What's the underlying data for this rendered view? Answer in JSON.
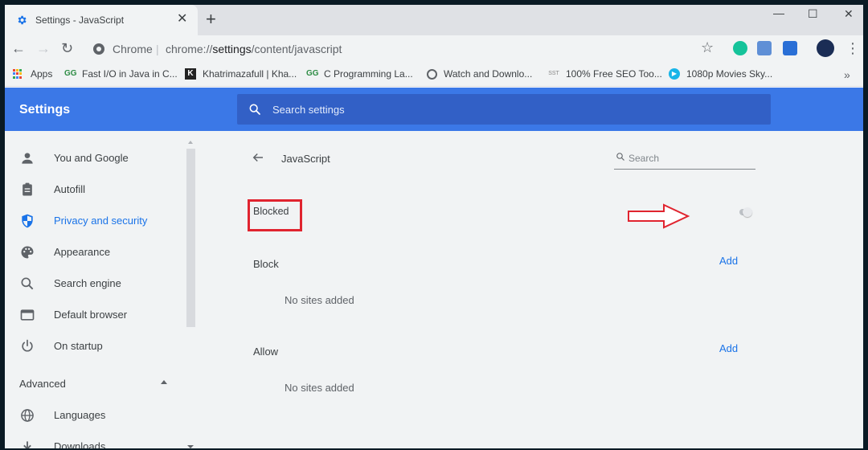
{
  "colors": {
    "header_bg": "#3b78e7",
    "search_bg": "#3260c6",
    "accent": "#1a73e8",
    "highlight_red": "#e0242f"
  },
  "tab": {
    "title": "Settings - JavaScript",
    "icon": "gear-icon",
    "close_glyph": "✕",
    "new_tab_glyph": "+"
  },
  "window_controls": {
    "minimize": "—",
    "maximize": "☐",
    "close": "✕"
  },
  "toolbar": {
    "back_glyph": "←",
    "forward_glyph": "→",
    "reload_glyph": "↻",
    "origin": "Chrome",
    "separator": "|",
    "url_prefix": "chrome://",
    "url_host": "settings",
    "url_path": "/content/javascript",
    "menu_glyph": "⋮",
    "star_glyph": "☆"
  },
  "bookmarks": {
    "items": [
      {
        "label": "Apps",
        "icon": "apps-icon"
      },
      {
        "label": "Fast I/O in Java in C...",
        "icon": "gfg-icon"
      },
      {
        "label": "Khatrimazafull | Kha...",
        "icon": "k-icon"
      },
      {
        "label": "C Programming La...",
        "icon": "gfg-icon"
      },
      {
        "label": "Watch and Downlo...",
        "icon": "globe-icon"
      },
      {
        "label": "100% Free SEO Too...",
        "icon": "sst-icon"
      },
      {
        "label": "1080p Movies Sky...",
        "icon": "play-icon"
      }
    ],
    "more_glyph": "»"
  },
  "header": {
    "title": "Settings",
    "search_placeholder": "Search settings"
  },
  "sidebar": {
    "items": [
      {
        "label": "You and Google",
        "icon": "person-icon",
        "active": false
      },
      {
        "label": "Autofill",
        "icon": "clipboard-icon",
        "active": false
      },
      {
        "label": "Privacy and security",
        "icon": "shield-icon",
        "active": true
      },
      {
        "label": "Appearance",
        "icon": "palette-icon",
        "active": false
      },
      {
        "label": "Search engine",
        "icon": "search-icon",
        "active": false
      },
      {
        "label": "Default browser",
        "icon": "browser-icon",
        "active": false
      },
      {
        "label": "On startup",
        "icon": "power-icon",
        "active": false
      }
    ],
    "advanced_label": "Advanced",
    "advanced_items": [
      {
        "label": "Languages",
        "icon": "globe-icon"
      },
      {
        "label": "Downloads",
        "icon": "download-icon"
      }
    ]
  },
  "content": {
    "title": "JavaScript",
    "search_placeholder": "Search",
    "status_label": "Blocked",
    "toggle_on": false,
    "sections": [
      {
        "label": "Block",
        "add_label": "Add",
        "empty_text": "No sites added"
      },
      {
        "label": "Allow",
        "add_label": "Add",
        "empty_text": "No sites added"
      }
    ]
  }
}
